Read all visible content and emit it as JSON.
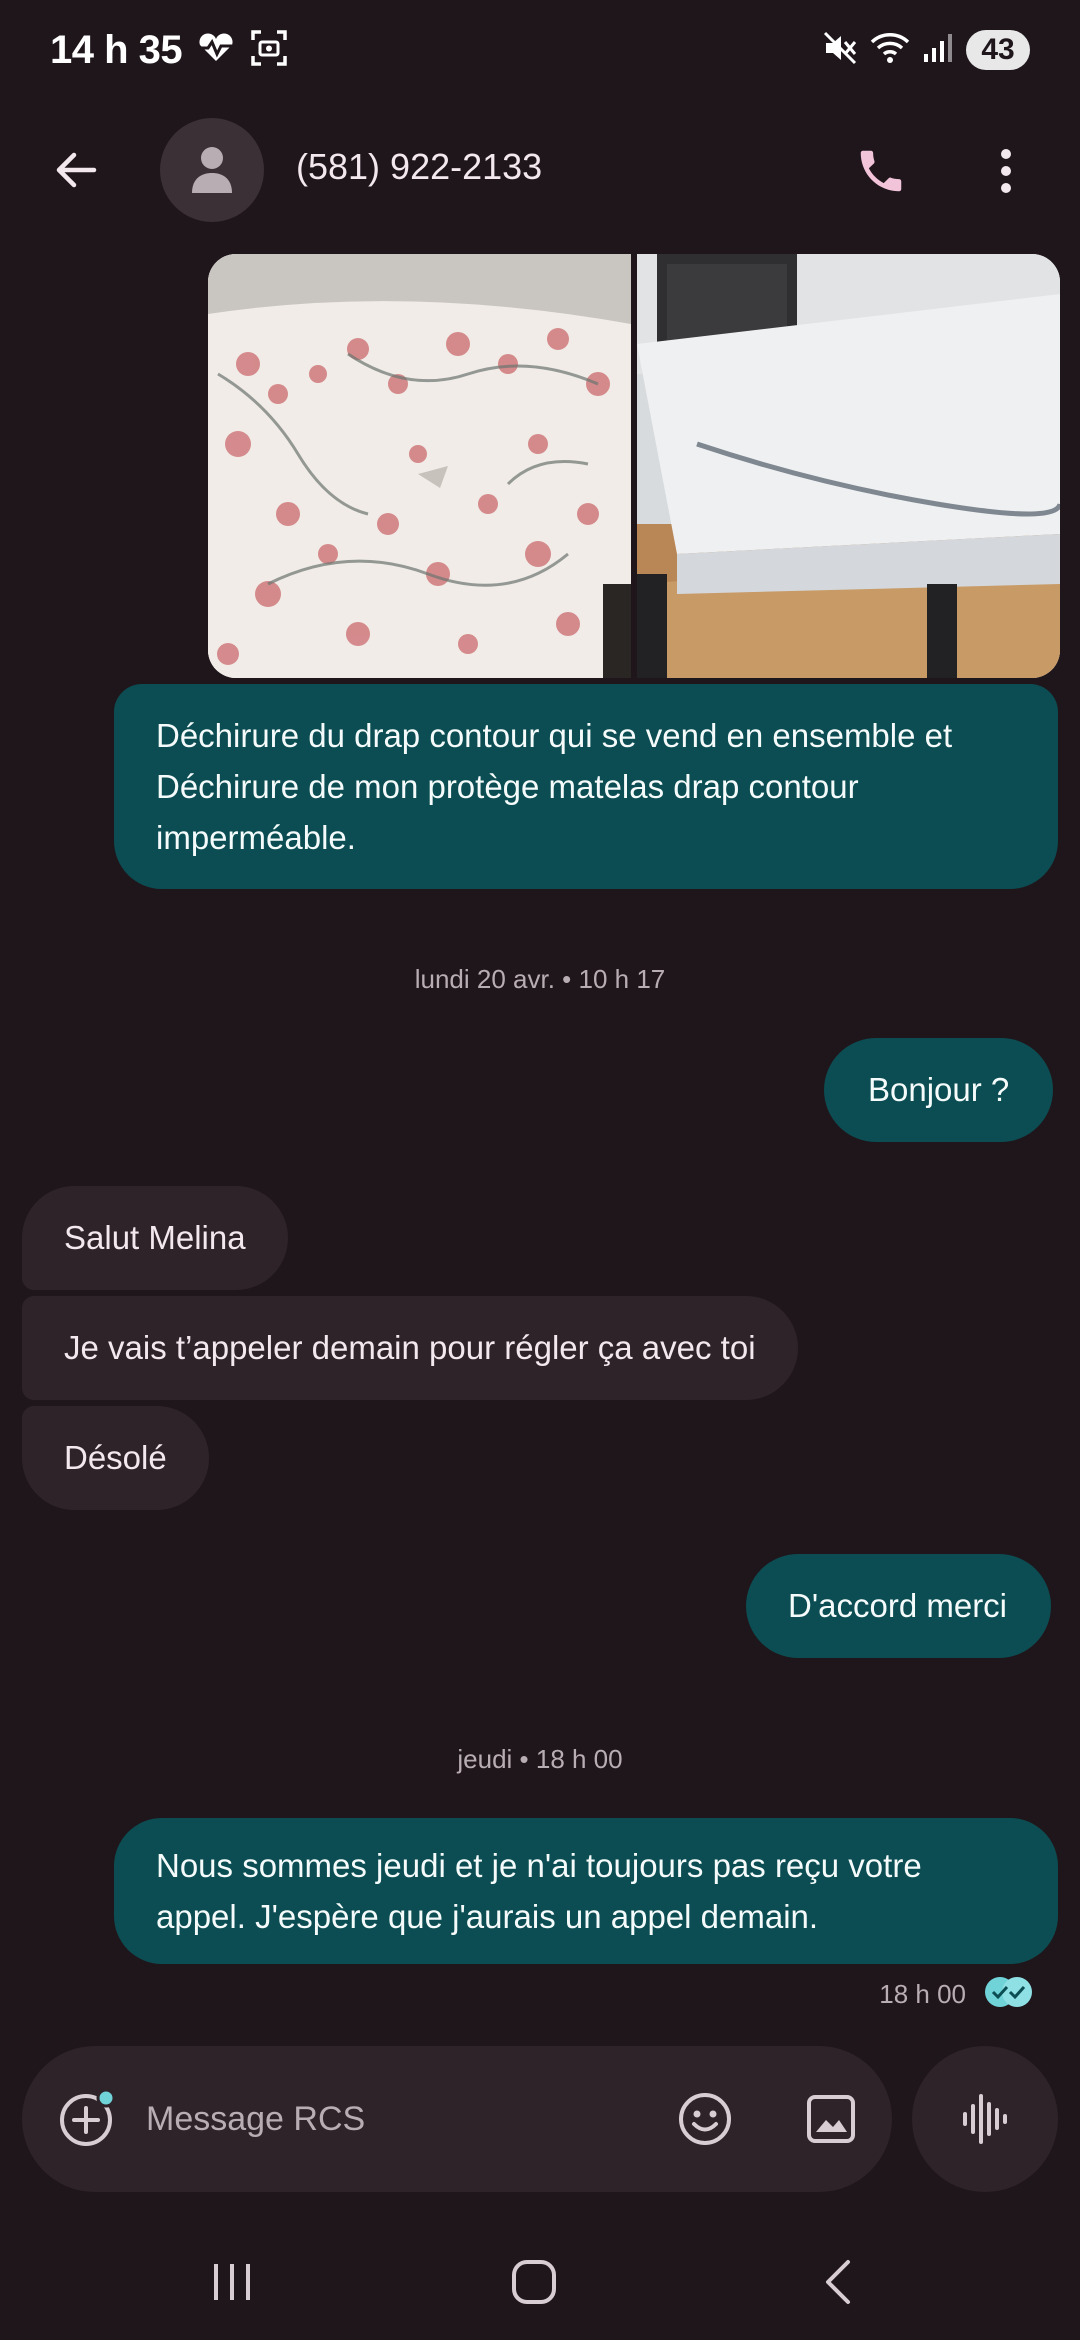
{
  "status_bar": {
    "time": "14 h 35",
    "battery": "43",
    "icons": [
      "heart-monitor-icon",
      "screenshot-icon",
      "mute-icon",
      "wifi-icon",
      "signal-icon",
      "battery-icon"
    ]
  },
  "header": {
    "contact": "(581) 922-2133",
    "icons": [
      "back-arrow-icon",
      "person-icon",
      "phone-icon",
      "more-vert-icon"
    ]
  },
  "messages": {
    "photo_caption": "Déchirure du drap contour qui se vend en ensemble et Déchirure de mon protège matelas drap contour imperméable.",
    "sep1": "lundi 20 avr. • 10 h 17",
    "m1": "Bonjour ?",
    "m2": "Salut Melina",
    "m3": "Je vais t’appeler demain pour régler ça avec toi",
    "m4": "Désolé",
    "m5": "D'accord merci",
    "sep2": "jeudi • 18 h 00",
    "m6": "Nous sommes jeudi et je n'ai toujours pas reçu votre appel. J'espère que j'aurais un appel demain.",
    "m6_time": "18 h 00"
  },
  "composer": {
    "placeholder": "Message RCS",
    "icons": [
      "add-attachment-icon",
      "emoji-icon",
      "gallery-icon",
      "voice-icon"
    ]
  },
  "navigation": {
    "icons": [
      "recents-icon",
      "home-icon",
      "back-icon"
    ]
  },
  "colors": {
    "background": "#1f161c",
    "outgoing_bubble": "#0b4d52",
    "incoming_bubble": "#2d2329",
    "accent_read": "#6fd3d8"
  }
}
